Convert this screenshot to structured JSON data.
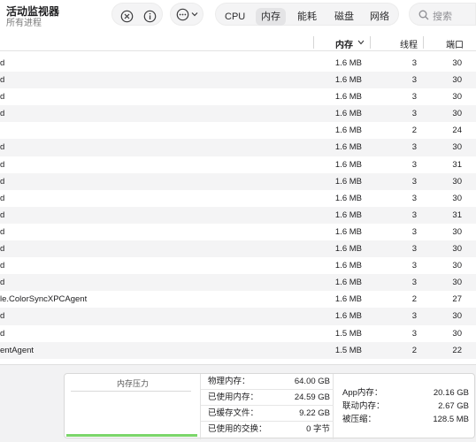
{
  "app": {
    "title": "活动监视器",
    "subtitle": "所有进程"
  },
  "toolbar": {
    "tabs": [
      {
        "label": "CPU",
        "active": false
      },
      {
        "label": "内存",
        "active": true
      },
      {
        "label": "能耗",
        "active": false
      },
      {
        "label": "磁盘",
        "active": false
      },
      {
        "label": "网络",
        "active": false
      }
    ],
    "search_placeholder": "搜索"
  },
  "table": {
    "columns": {
      "memory": "内存",
      "threads": "线程",
      "ports": "端口"
    },
    "rows": [
      {
        "name": "d",
        "memory": "1.6 MB",
        "threads": "3",
        "ports": "30"
      },
      {
        "name": "d",
        "memory": "1.6 MB",
        "threads": "3",
        "ports": "30"
      },
      {
        "name": "d",
        "memory": "1.6 MB",
        "threads": "3",
        "ports": "30"
      },
      {
        "name": "d",
        "memory": "1.6 MB",
        "threads": "3",
        "ports": "30"
      },
      {
        "name": "",
        "memory": "1.6 MB",
        "threads": "2",
        "ports": "24"
      },
      {
        "name": "d",
        "memory": "1.6 MB",
        "threads": "3",
        "ports": "30"
      },
      {
        "name": "d",
        "memory": "1.6 MB",
        "threads": "3",
        "ports": "31"
      },
      {
        "name": "d",
        "memory": "1.6 MB",
        "threads": "3",
        "ports": "30"
      },
      {
        "name": "d",
        "memory": "1.6 MB",
        "threads": "3",
        "ports": "30"
      },
      {
        "name": "d",
        "memory": "1.6 MB",
        "threads": "3",
        "ports": "31"
      },
      {
        "name": "d",
        "memory": "1.6 MB",
        "threads": "3",
        "ports": "30"
      },
      {
        "name": "d",
        "memory": "1.6 MB",
        "threads": "3",
        "ports": "30"
      },
      {
        "name": "d",
        "memory": "1.6 MB",
        "threads": "3",
        "ports": "30"
      },
      {
        "name": "d",
        "memory": "1.6 MB",
        "threads": "3",
        "ports": "30"
      },
      {
        "name": "le.ColorSyncXPCAgent",
        "memory": "1.6 MB",
        "threads": "2",
        "ports": "27"
      },
      {
        "name": "d",
        "memory": "1.6 MB",
        "threads": "3",
        "ports": "30"
      },
      {
        "name": "d",
        "memory": "1.5 MB",
        "threads": "3",
        "ports": "30"
      },
      {
        "name": "entAgent",
        "memory": "1.5 MB",
        "threads": "2",
        "ports": "22"
      }
    ]
  },
  "summary": {
    "pressure_title": "内存压力",
    "pressure_color": "#7bd66a",
    "physical_label": "物理内存：",
    "physical_value": "64.00 GB",
    "used_label": "已使用内存：",
    "used_value": "24.59 GB",
    "cached_label": "已缓存文件：",
    "cached_value": "9.22 GB",
    "swap_label": "已使用的交换：",
    "swap_value": "0 字节",
    "app_label": "App内存：",
    "app_value": "20.16 GB",
    "wired_label": "联动内存：",
    "wired_value": "2.67 GB",
    "compressed_label": "被压缩：",
    "compressed_value": "128.5 MB"
  }
}
